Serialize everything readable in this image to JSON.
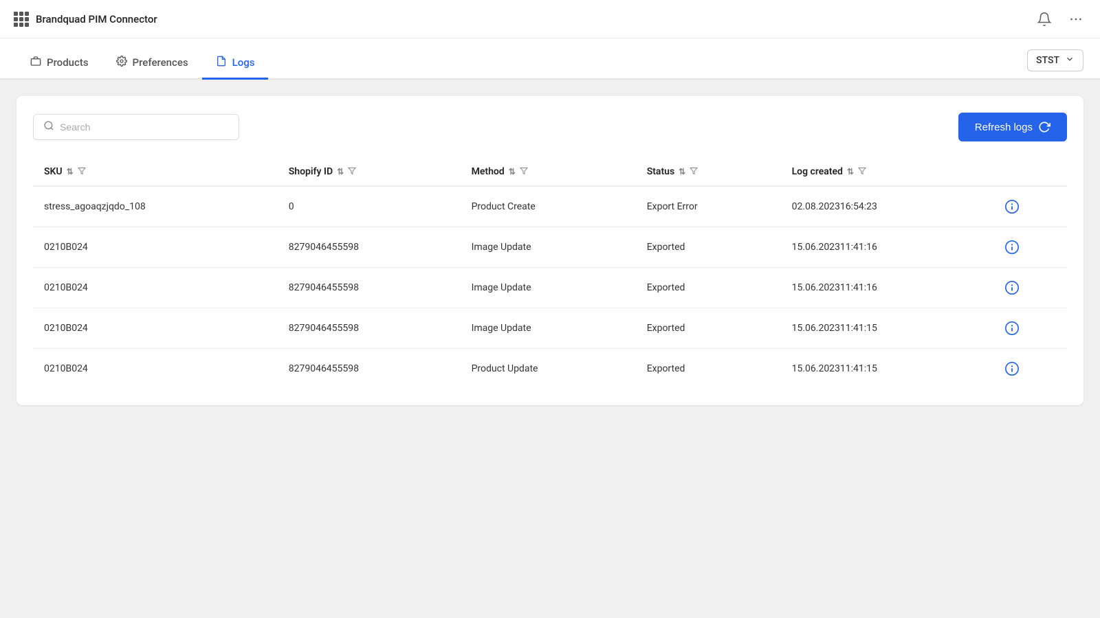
{
  "app": {
    "title": "Brandquad PIM Connector"
  },
  "nav": {
    "tabs": [
      {
        "id": "products",
        "label": "Products",
        "icon": "briefcase"
      },
      {
        "id": "preferences",
        "label": "Preferences",
        "icon": "gear"
      },
      {
        "id": "logs",
        "label": "Logs",
        "icon": "document",
        "active": true
      }
    ],
    "store_selector": {
      "value": "STST",
      "options": [
        "STST"
      ]
    }
  },
  "toolbar": {
    "search_placeholder": "Search",
    "refresh_label": "Refresh logs"
  },
  "table": {
    "columns": [
      {
        "id": "sku",
        "label": "SKU"
      },
      {
        "id": "shopify_id",
        "label": "Shopify ID"
      },
      {
        "id": "method",
        "label": "Method"
      },
      {
        "id": "status",
        "label": "Status"
      },
      {
        "id": "log_created",
        "label": "Log created"
      }
    ],
    "rows": [
      {
        "sku": "stress_agoaqzjqdo_108",
        "shopify_id": "0",
        "method": "Product Create",
        "status": "Export Error",
        "log_created": "02.08.202316:54:23"
      },
      {
        "sku": "0210B024",
        "shopify_id": "8279046455598",
        "method": "Image Update",
        "status": "Exported",
        "log_created": "15.06.202311:41:16"
      },
      {
        "sku": "0210B024",
        "shopify_id": "8279046455598",
        "method": "Image Update",
        "status": "Exported",
        "log_created": "15.06.202311:41:16"
      },
      {
        "sku": "0210B024",
        "shopify_id": "8279046455598",
        "method": "Image Update",
        "status": "Exported",
        "log_created": "15.06.202311:41:15"
      },
      {
        "sku": "0210B024",
        "shopify_id": "8279046455598",
        "method": "Product Update",
        "status": "Exported",
        "log_created": "15.06.202311:41:15"
      }
    ]
  }
}
